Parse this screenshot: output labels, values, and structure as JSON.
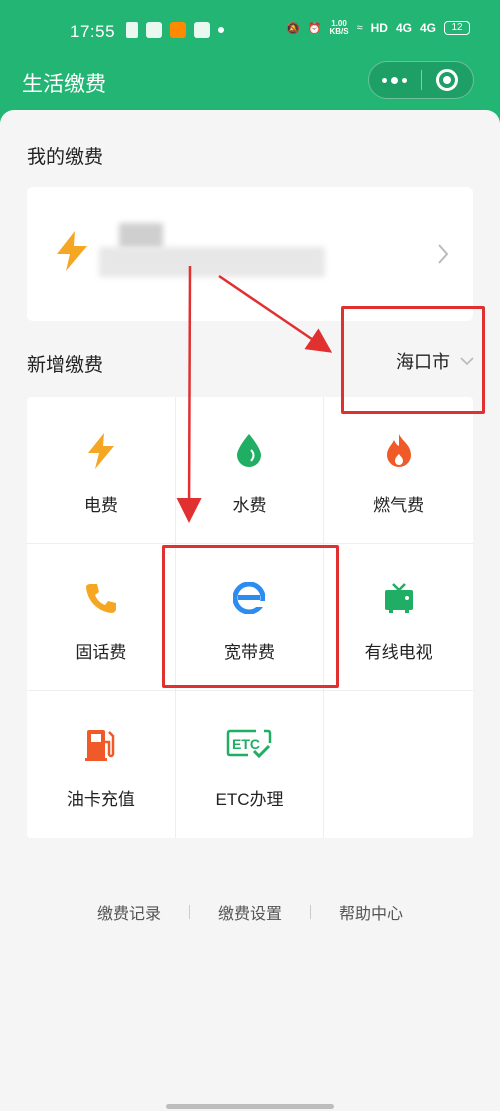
{
  "status_bar": {
    "time": "17:55",
    "net_speed_value": "1.00",
    "net_speed_unit": "KB/S",
    "hd_label": "HD",
    "signal_1": "4G",
    "signal_2": "4G",
    "battery": "12"
  },
  "header": {
    "title": "生活缴费"
  },
  "my_payments": {
    "title": "我的缴费",
    "card": {
      "icon": "lightning-icon"
    }
  },
  "new_payment": {
    "title": "新增缴费",
    "city": "海口市"
  },
  "services": [
    {
      "label": "电费",
      "icon": "lightning-icon",
      "color": "#f5a623"
    },
    {
      "label": "水费",
      "icon": "water-drop-icon",
      "color": "#1fae63"
    },
    {
      "label": "燃气费",
      "icon": "flame-icon",
      "color": "#f05a28"
    },
    {
      "label": "固话费",
      "icon": "phone-icon",
      "color": "#f5a623"
    },
    {
      "label": "宽带费",
      "icon": "ie-browser-icon",
      "color": "#2d8cf0"
    },
    {
      "label": "有线电视",
      "icon": "tv-icon",
      "color": "#1fae63"
    },
    {
      "label": "油卡充值",
      "icon": "gas-pump-icon",
      "color": "#f05a28"
    },
    {
      "label": "ETC办理",
      "icon": "etc-icon",
      "color": "#1fae63",
      "badge": "ETC"
    }
  ],
  "footer": {
    "links": [
      "缴费记录",
      "缴费设置",
      "帮助中心"
    ]
  },
  "colors": {
    "brand": "#22b573",
    "annotation": "#e03030"
  }
}
